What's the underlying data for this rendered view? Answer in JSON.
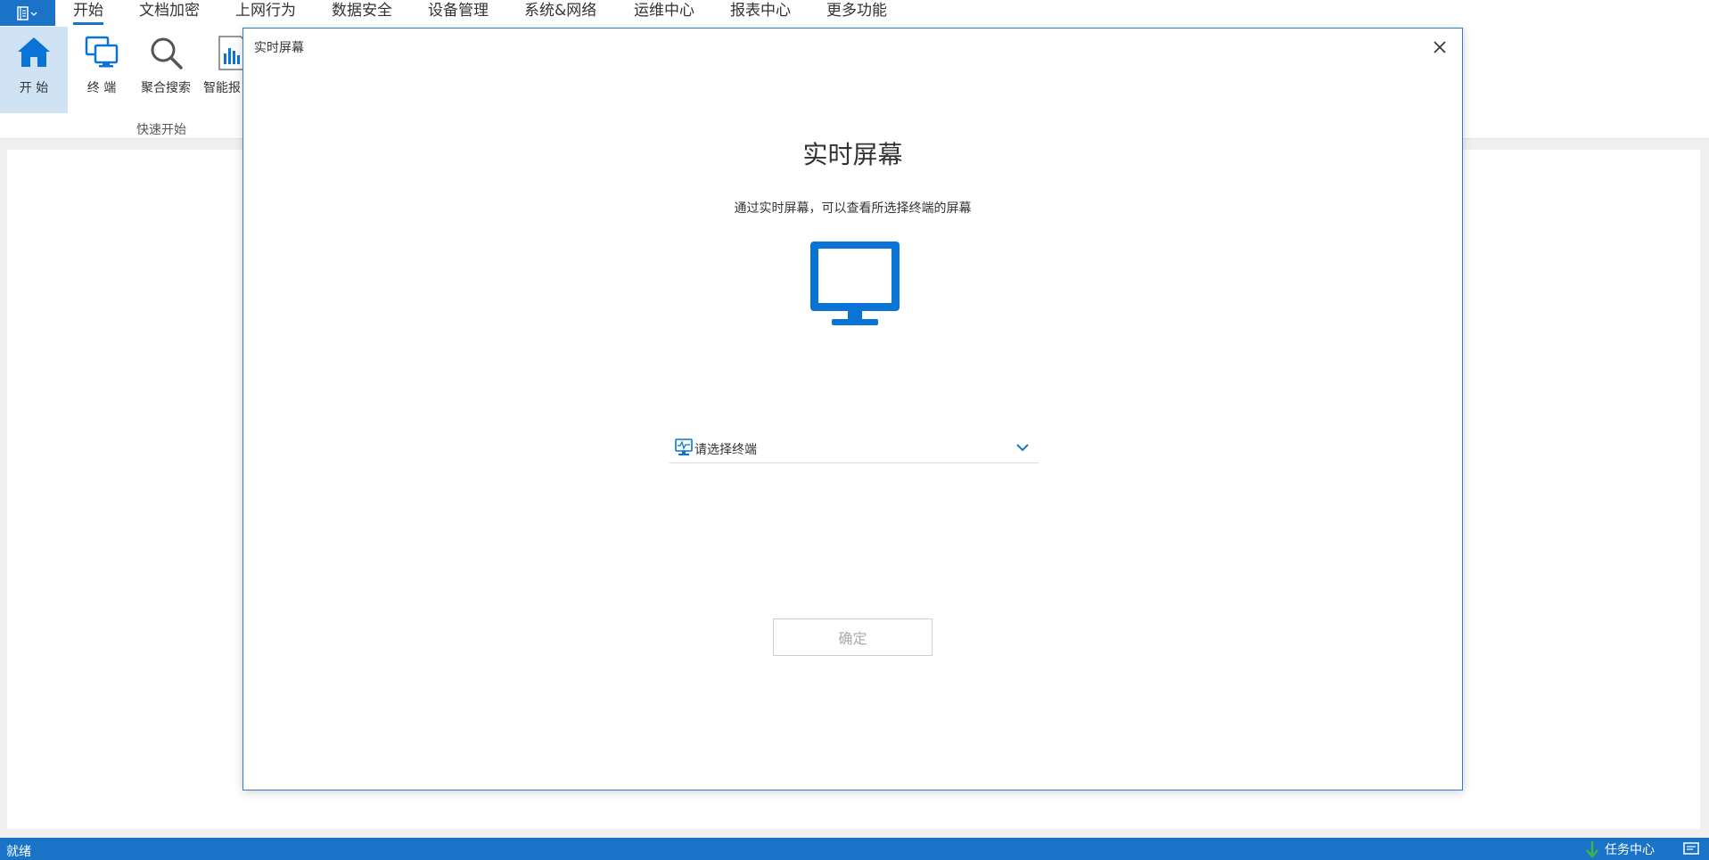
{
  "menubar": {
    "app_menu_icon": "app-menu-icon",
    "tabs": [
      {
        "label": "开始",
        "active": true
      },
      {
        "label": "文档加密"
      },
      {
        "label": "上网行为"
      },
      {
        "label": "数据安全"
      },
      {
        "label": "设备管理"
      },
      {
        "label": "系统&网络"
      },
      {
        "label": "运维中心"
      },
      {
        "label": "报表中心"
      },
      {
        "label": "更多功能"
      }
    ]
  },
  "ribbon": {
    "buttons": [
      {
        "label": "开 始",
        "icon": "home-icon",
        "selected": true
      },
      {
        "label": "终 端",
        "icon": "terminal-icon"
      },
      {
        "label": "聚合搜索",
        "icon": "search-icon"
      },
      {
        "label": "智能报",
        "icon": "report-icon"
      }
    ],
    "group_label": "快速开始"
  },
  "dialog": {
    "title": "实时屏幕",
    "close_icon": "close-icon",
    "heading": "实时屏幕",
    "description": "通过实时屏幕，可以查看所选择终端的屏幕",
    "illustration_icon": "monitor-icon",
    "terminal_select": {
      "placeholder": "请选择终端",
      "icon": "terminal-screen-icon",
      "arrow_icon": "chevron-down-icon"
    },
    "confirm_label": "确定"
  },
  "statusbar": {
    "status": "就绪",
    "task_center_label": "任务中心",
    "task_center_icon": "download-arrow-icon",
    "right_icon": "message-icon"
  },
  "colors": {
    "accent": "#1a73c7",
    "selected_bg": "#cfe3f5",
    "icon_blue": "#0a74d6"
  }
}
